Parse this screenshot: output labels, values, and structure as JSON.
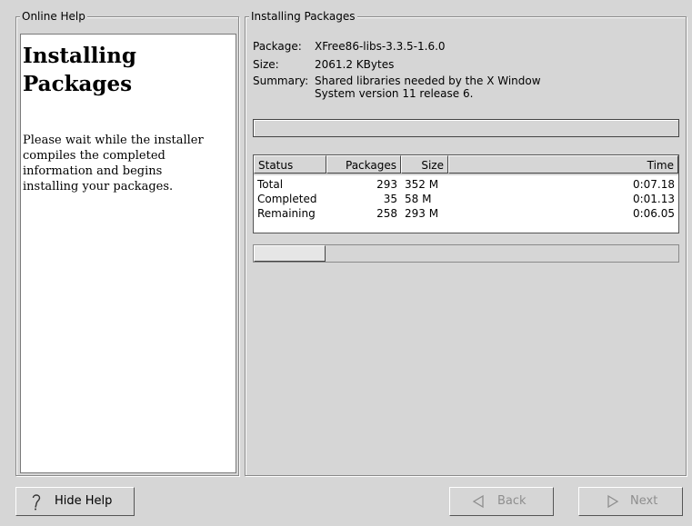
{
  "help": {
    "frame_title": "Online Help",
    "title_line1": "Installing",
    "title_line2": "Packages",
    "body": "Please wait while the installer compiles the completed information and begins installing your packages."
  },
  "install": {
    "frame_title": "Installing Packages",
    "package_label": "Package:",
    "package_value": "XFree86-libs-3.3.5-1.6.0",
    "size_label": "Size:",
    "size_value": "2061.2 KBytes",
    "summary_label": "Summary:",
    "summary_line1": "Shared libraries needed by the X Window",
    "summary_line2": "System version 11 release 6.",
    "package_progress_fraction": 0.0,
    "total_progress_fraction": 0.17,
    "table": {
      "headers": [
        "Status",
        "Packages",
        "Size",
        "Time"
      ],
      "rows": [
        [
          "Total",
          "293",
          "352 M",
          "0:07.18"
        ],
        [
          "Completed",
          "35",
          "58 M",
          "0:01.13"
        ],
        [
          "Remaining",
          "258",
          "293 M",
          "0:06.05"
        ]
      ]
    }
  },
  "buttons": {
    "hide_help": "Hide Help",
    "back": "Back",
    "next": "Next",
    "hide_help_icon": "question-icon",
    "back_icon": "triangle-left-icon",
    "next_icon": "triangle-right-icon"
  }
}
